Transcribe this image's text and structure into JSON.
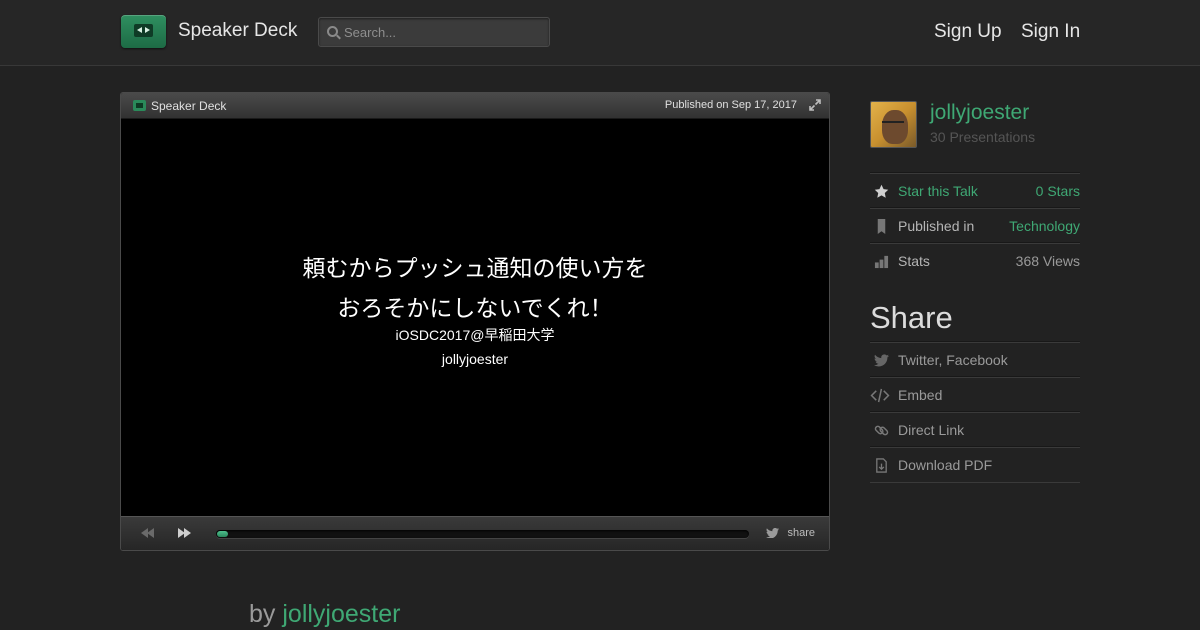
{
  "header": {
    "brand": "Speaker Deck",
    "search_placeholder": "Search...",
    "sign_up": "Sign Up",
    "sign_in": "Sign In"
  },
  "player": {
    "brand": "Speaker Deck",
    "published": "Published on Sep 17, 2017",
    "slide": {
      "title": "頼むからプッシュ通知の使い方を\nおろそかにしないでくれ！",
      "event": "iOSDC2017@早稲田大学",
      "author": "jollyjoester"
    },
    "progress": 0.02,
    "share_label": "share"
  },
  "sidebar": {
    "author_name": "jollyjoester",
    "presentations": "30 Presentations",
    "star_label": "Star this Talk",
    "star_count": "0 Stars",
    "published_in_label": "Published in",
    "category": "Technology",
    "stats_label": "Stats",
    "views": "368 Views",
    "share_heading": "Share",
    "share_items": [
      "Twitter, Facebook",
      "Embed",
      "Direct Link",
      "Download PDF"
    ]
  },
  "byline": {
    "prefix": "by",
    "author": "jollyjoester"
  },
  "colors": {
    "accent": "#3fa874",
    "background": "#222222"
  }
}
